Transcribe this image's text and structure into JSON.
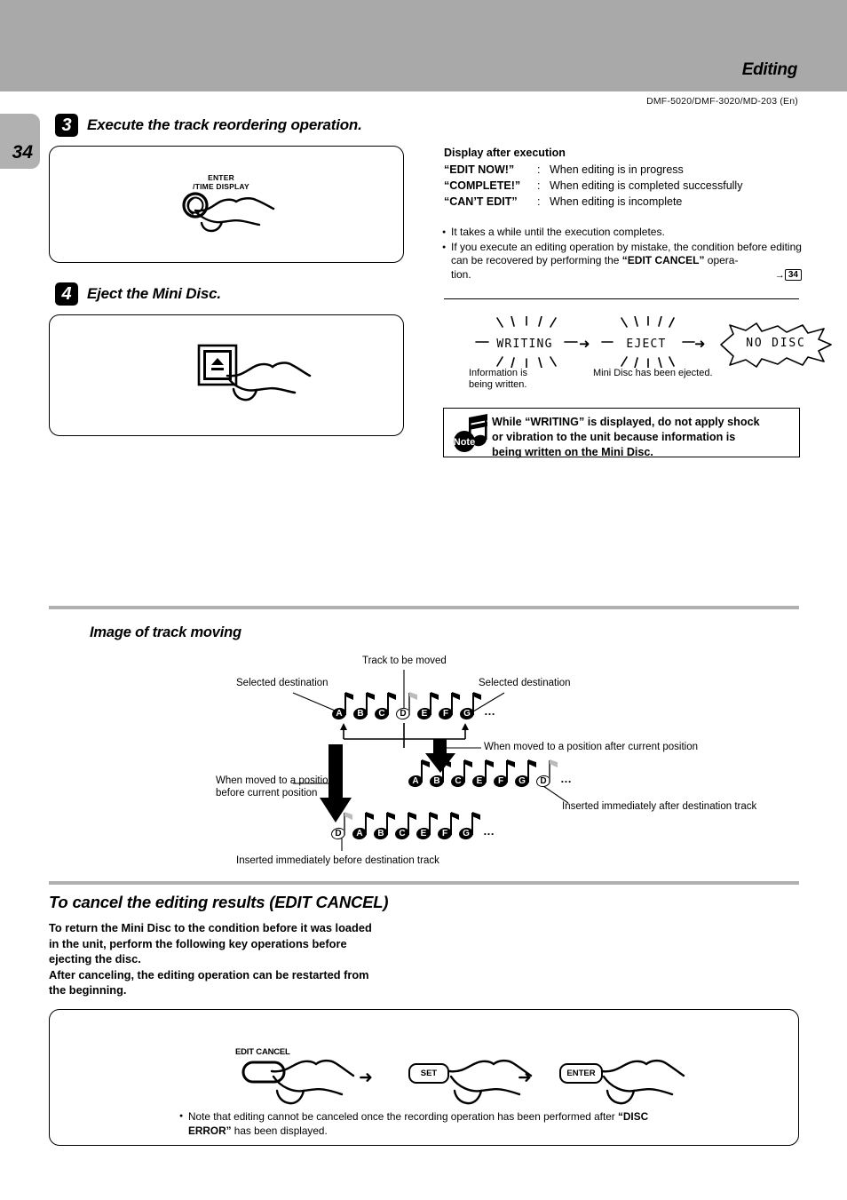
{
  "header": {
    "title": "Editing",
    "model_line": "DMF-5020/DMF-3020/MD-203 (En)",
    "page_number": "34",
    "band_color": "#a9a9a9"
  },
  "steps": [
    {
      "number": "3",
      "title": "Execute the track reordering operation.",
      "illustration": {
        "key_label_line1": "ENTER",
        "key_label_line2": "/TIME DISPLAY",
        "icon": "round-key-with-hand"
      }
    },
    {
      "number": "4",
      "title": "Eject the Mini Disc.",
      "illustration": {
        "key_label_line1": "",
        "key_label_line2": "",
        "icon": "eject-key-with-hand"
      }
    }
  ],
  "display_after_execution": {
    "heading": "Display after execution",
    "rows": [
      {
        "term": "“EDIT NOW!”",
        "colon": ":",
        "desc": "When editing is in progress"
      },
      {
        "term": "“COMPLETE!”",
        "colon": ":",
        "desc": "When editing is completed successfully"
      },
      {
        "term": "“CAN’T EDIT”",
        "colon": ":",
        "desc": "When editing is incomplete"
      }
    ]
  },
  "notes_right": {
    "bullet1": "It takes a while until the execution completes.",
    "bullet2_pre": "If you execute an editing operation by mistake, the condition before editing can be recovered by performing the ",
    "bullet2_bold": "“EDIT CANCEL”",
    "bullet2_post": " opera-",
    "bullet2_line3": "tion.",
    "page_ref_arrow": "→",
    "page_ref": "34"
  },
  "display_flow": {
    "items": [
      {
        "text": "WRITING",
        "style": "flashing",
        "caption_line1": "Information is",
        "caption_line2": "being written."
      },
      {
        "text": "EJECT",
        "style": "flashing",
        "caption_line1": "Mini Disc has been ejected.",
        "caption_line2": ""
      },
      {
        "text": "NO DISC",
        "style": "burst",
        "caption_line1": "",
        "caption_line2": ""
      }
    ],
    "arrow": "➜"
  },
  "note_box": {
    "icon_label": "Note",
    "line1": "While “WRITING” is displayed, do not apply shock",
    "line2": "or  vibration  to  the  unit  because  information  is",
    "line3": "being written on the Mini Disc."
  },
  "track_moving": {
    "section_title": "Image of track moving",
    "labels": {
      "track_to_be_moved": "Track to be moved",
      "selected_destination_left": "Selected destination",
      "selected_destination_right": "Selected destination",
      "after_current_position": "When moved to a position after current position",
      "before_current_position_line1": "When moved to a position",
      "before_current_position_line2": "before current position",
      "inserted_after": "Inserted immediately after destination track",
      "inserted_before": "Inserted immediately before destination track"
    },
    "row_original": {
      "tracks": [
        "A",
        "B",
        "C",
        "D",
        "E",
        "F",
        "G"
      ],
      "moved": "D",
      "ellipsis": "…"
    },
    "row_after": {
      "tracks": [
        "A",
        "B",
        "C",
        "E",
        "F",
        "G",
        "D"
      ],
      "moved": "D",
      "ellipsis": "…"
    },
    "row_before": {
      "tracks": [
        "D",
        "A",
        "B",
        "C",
        "E",
        "F",
        "G"
      ],
      "moved": "D",
      "ellipsis": "…"
    }
  },
  "edit_cancel": {
    "section_title": "To cancel the editing results (EDIT CANCEL)",
    "body_line1": "To return the Mini Disc to the condition before it was loaded",
    "body_line2": "in  the  unit,  perform  the  following  key  operations  before",
    "body_line3": "ejecting the disc.",
    "body_line4": "After canceling, the editing operation can be restarted from",
    "body_line5": "the beginning.",
    "keys": [
      {
        "label": "EDIT CANCEL",
        "label_position": "above",
        "cap_text": ""
      },
      {
        "label": "SET",
        "label_position": "inside",
        "cap_text": "SET"
      },
      {
        "label": "ENTER",
        "label_position": "inside",
        "cap_text": "ENTER"
      }
    ],
    "arrow": "➜",
    "note_pre": "Note that editing cannot be canceled once the recording operation has been performed after ",
    "note_bold1": "“DISC",
    "note_bold2": "ERROR”",
    "note_post": " has been displayed."
  }
}
